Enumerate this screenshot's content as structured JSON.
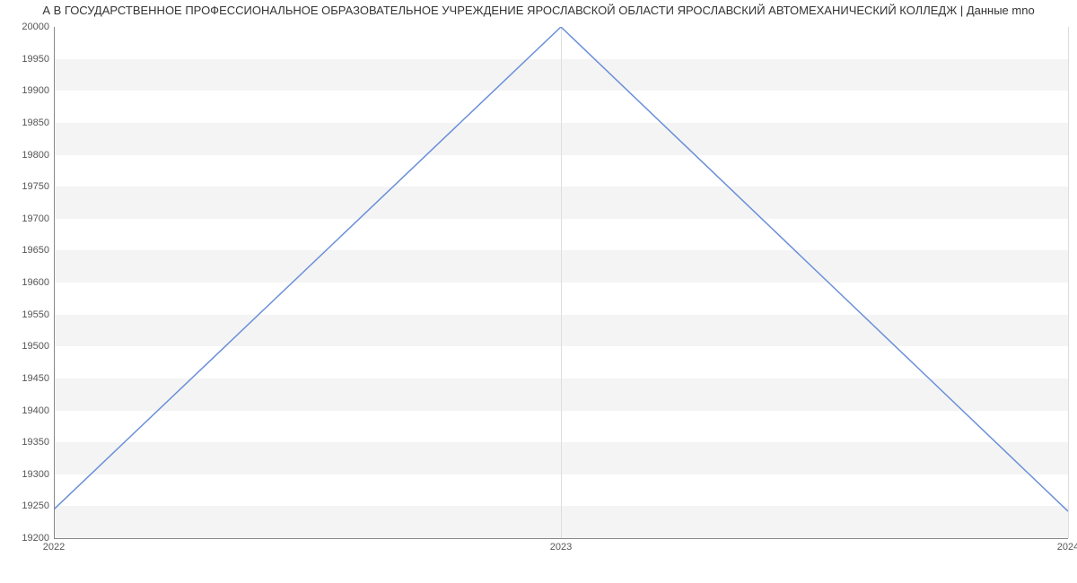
{
  "chart_data": {
    "type": "line",
    "title": "А В ГОСУДАРСТВЕННОЕ ПРОФЕССИОНАЛЬНОЕ ОБРАЗОВАТЕЛЬНОЕ УЧРЕЖДЕНИЕ ЯРОСЛАВСКОЙ ОБЛАСТИ ЯРОСЛАВСКИЙ АВТОМЕХАНИЧЕСКИЙ КОЛЛЕДЖ | Данные mno",
    "x": [
      2022,
      2023,
      2024
    ],
    "values": [
      19245,
      20000,
      19242
    ],
    "xlabel": "",
    "ylabel": "",
    "xlim": [
      2022,
      2024
    ],
    "ylim": [
      19200,
      20000
    ],
    "yticks": [
      19200,
      19250,
      19300,
      19350,
      19400,
      19450,
      19500,
      19550,
      19600,
      19650,
      19700,
      19750,
      19800,
      19850,
      19900,
      19950,
      20000
    ],
    "xticks": [
      2022,
      2023,
      2024
    ]
  }
}
